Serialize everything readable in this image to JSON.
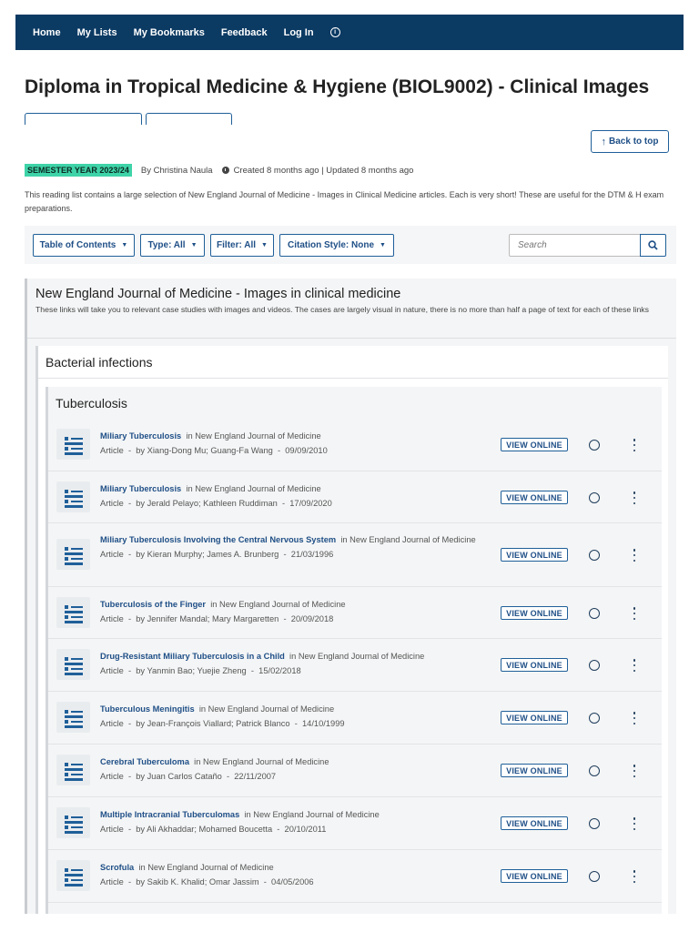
{
  "nav": {
    "items": [
      "Home",
      "My Lists",
      "My Bookmarks",
      "Feedback",
      "Log In"
    ],
    "info_icon": "info-circle-icon"
  },
  "page": {
    "title": "Diploma in Tropical Medicine & Hygiene (BIOL9002) - Clinical Images",
    "back_to_top": "Back to top",
    "semester_badge": "SEMESTER YEAR 2023/24",
    "author": "By Christina Naula",
    "updated": "Created 8 months ago | Updated 8 months ago",
    "description": "This reading list contains a large selection of New England Journal of Medicine - Images in Clinical Medicine articles. Each is very short! These are useful for the DTM & H exam preparations.",
    "badge_color": "#3ed3a8",
    "nav_color": "#0b3a63",
    "accent_color": "#1f5f99"
  },
  "toolbar": {
    "toc": "Table of Contents",
    "type": "Type: All",
    "filter": "Filter: All",
    "citation": "Citation Style: None",
    "search_placeholder": "Search"
  },
  "section": {
    "title": "New England Journal of Medicine - Images in clinical medicine",
    "description": "These links will take you to relevant case studies with images and videos. The cases are largely visual in nature, there is no more than half a page of text for each of these links",
    "subsection": {
      "title": "Bacterial infections",
      "subsubsection": {
        "title": "Tuberculosis",
        "items": [
          {
            "title": "Miliary Tuberculosis",
            "journal": "in New England Journal of Medicine",
            "meta": "Article  -  by Xiang-Dong Mu; Guang-Fa Wang  -  09/09/2010",
            "action": "VIEW ONLINE"
          },
          {
            "title": "Miliary Tuberculosis",
            "journal": "in New England Journal of Medicine",
            "meta": "Article  -  by Jerald Pelayo; Kathleen Ruddiman  -  17/09/2020",
            "action": "VIEW ONLINE"
          },
          {
            "title": "Miliary Tuberculosis Involving the Central Nervous System",
            "journal": "in New England Journal of Medicine",
            "meta": "Article  -  by Kieran Murphy; James A. Brunberg  -  21/03/1996",
            "action": "VIEW ONLINE"
          },
          {
            "title": "Tuberculosis of the Finger",
            "journal": "in New England Journal of Medicine",
            "meta": "Article  -  by Jennifer Mandal; Mary Margaretten  -  20/09/2018",
            "action": "VIEW ONLINE"
          },
          {
            "title": "Drug-Resistant Miliary Tuberculosis in a Child",
            "journal": "in New England Journal of Medicine",
            "meta": "Article  -  by Yanmin Bao; Yuejie Zheng  -  15/02/2018",
            "action": "VIEW ONLINE"
          },
          {
            "title": "Tuberculous Meningitis",
            "journal": "in New England Journal of Medicine",
            "meta": "Article  -  by Jean-François Viallard; Patrick Blanco  -  14/10/1999",
            "action": "VIEW ONLINE"
          },
          {
            "title": "Cerebral Tuberculoma",
            "journal": "in New England Journal of Medicine",
            "meta": "Article  -  by Juan Carlos Cataño  -  22/11/2007",
            "action": "VIEW ONLINE"
          },
          {
            "title": "Multiple Intracranial Tuberculomas",
            "journal": "in New England Journal of Medicine",
            "meta": "Article  -  by Ali Akhaddar; Mohamed Boucetta  -  20/10/2011",
            "action": "VIEW ONLINE"
          },
          {
            "title": "Scrofula",
            "journal": "in New England Journal of Medicine",
            "meta": "Article  -  by Sakib K. Khalid; Omar Jassim  -  04/05/2006",
            "action": "VIEW ONLINE"
          }
        ]
      }
    }
  }
}
